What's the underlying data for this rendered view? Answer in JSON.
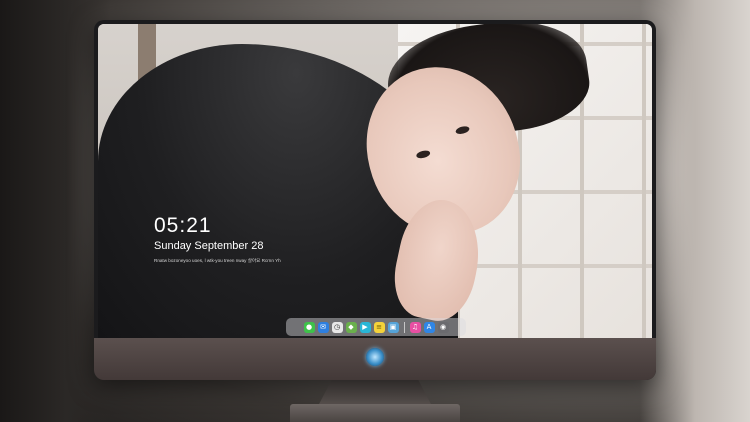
{
  "lockscreen": {
    "time": "05:21",
    "date": "Sunday September  28",
    "note": "Rnatw bozoneyoo uoes, l wtk-you treen nway 살아요 Rcrnn Yh"
  },
  "dock": {
    "items": [
      {
        "name": "messages-icon",
        "glyph": "●",
        "color": "#3ec24a"
      },
      {
        "name": "mail-icon",
        "glyph": "✉",
        "color": "#2d7fe0"
      },
      {
        "name": "clock-icon",
        "glyph": "◷",
        "color": "#e8e8e8"
      },
      {
        "name": "photos-icon",
        "glyph": "◆",
        "color": "#6ab04c"
      },
      {
        "name": "video-icon",
        "glyph": "▶",
        "color": "#29b6d6"
      },
      {
        "name": "notes-icon",
        "glyph": "≡",
        "color": "#f5d23a"
      },
      {
        "name": "preview-icon",
        "glyph": "▣",
        "color": "#55a3d8"
      },
      {
        "name": "music-icon",
        "glyph": "♫",
        "color": "#e84fa3"
      },
      {
        "name": "app-store-icon",
        "glyph": "A",
        "color": "#2f86e6"
      },
      {
        "name": "camera-icon",
        "glyph": "◉",
        "color": "#6b6b6f"
      }
    ]
  }
}
